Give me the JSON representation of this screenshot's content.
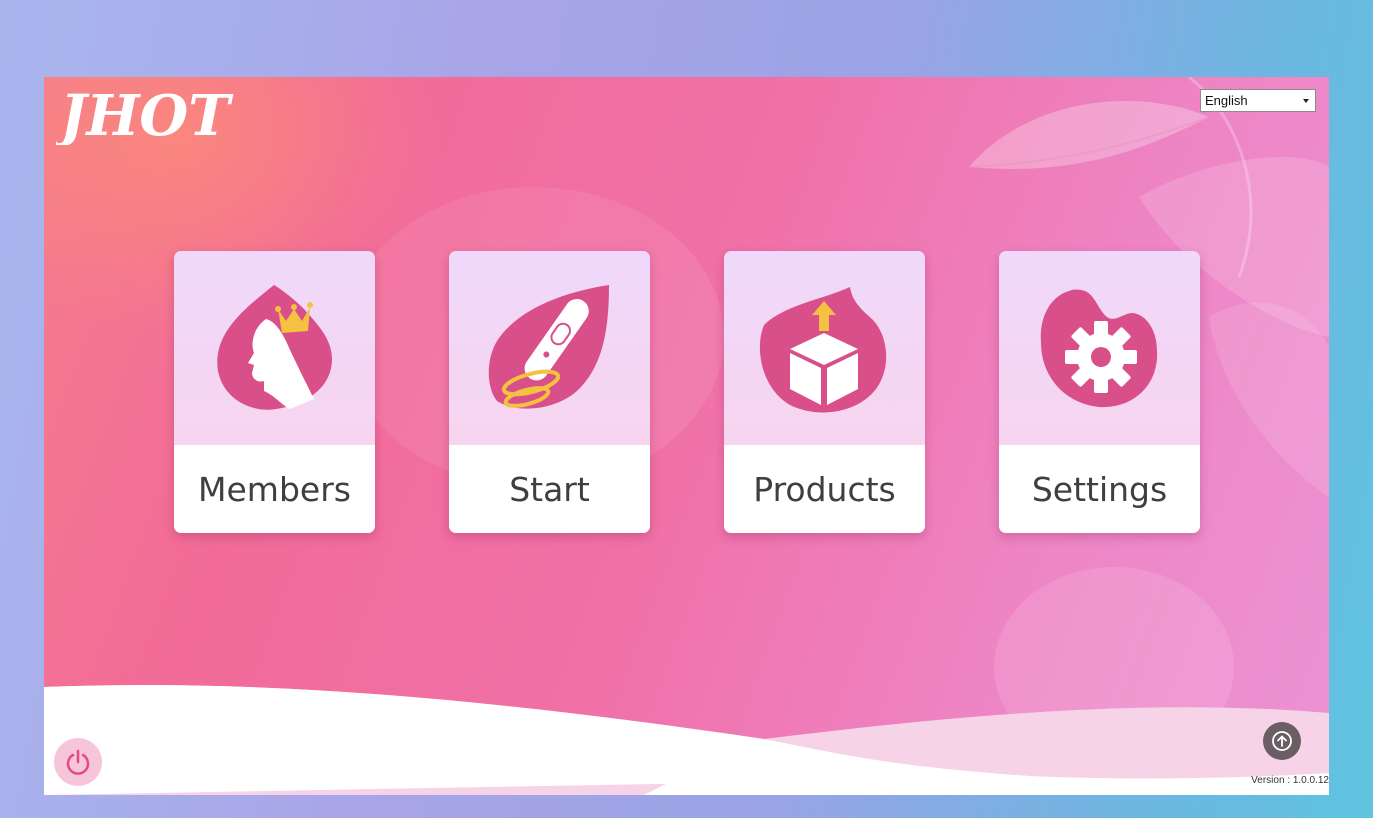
{
  "header": {
    "logo_text": "JHOT",
    "language_select": {
      "selected": "English"
    }
  },
  "tiles": [
    {
      "id": "members",
      "label": "Members",
      "icon": "woman-crown-icon"
    },
    {
      "id": "start",
      "label": "Start",
      "icon": "beauty-device-icon"
    },
    {
      "id": "products",
      "label": "Products",
      "icon": "box-upload-icon"
    },
    {
      "id": "settings",
      "label": "Settings",
      "icon": "gear-icon"
    }
  ],
  "footer": {
    "power_icon": "power-icon",
    "upload_icon": "arrow-up-circle-icon",
    "version": "Version : 1.0.0.12"
  },
  "colors": {
    "brand_pink": "#d94f8a",
    "accent_gold": "#f4c141",
    "tile_top": "#efd8fb",
    "label_text": "#3f3f3f"
  }
}
